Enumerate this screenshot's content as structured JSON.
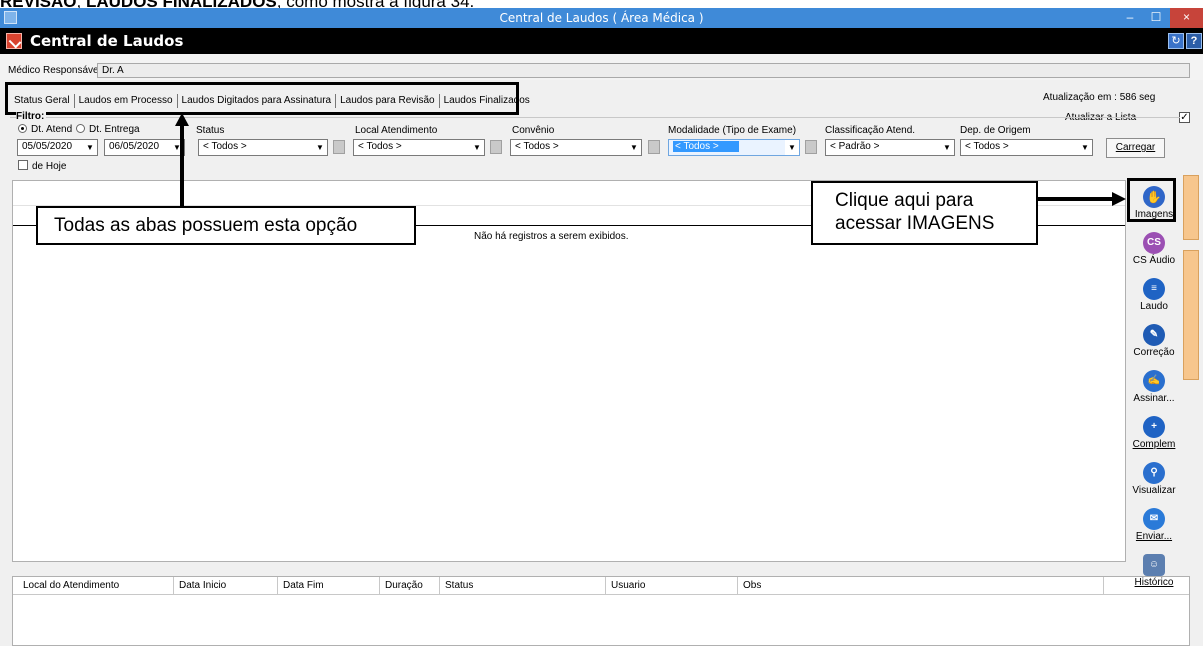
{
  "doc_text_bold1": "REVISÃO",
  "doc_text_sep": ", ",
  "doc_text_bold2": "LAUDOS FINALIZADOS",
  "doc_text_rest": ", como mostra a figura 34.",
  "window": {
    "title": "Central de Laudos ( Área Médica )",
    "min": "–",
    "max": "☐",
    "close": "×"
  },
  "app": {
    "name": "Central de Laudos",
    "sync": "↻",
    "help": "?"
  },
  "medico": {
    "label": "Médico Responsável:",
    "value": "Dr. A"
  },
  "tabs": [
    "Status Geral",
    "Laudos em Processo",
    "Laudos Digitados para Assinatura",
    "Laudos para Revisão",
    "Laudos Finalizados"
  ],
  "update": {
    "text": "Atualização em : 586 seg",
    "auto_label": "Atualizar a Lista",
    "auto_checked": "✓"
  },
  "filter": {
    "title": "Filtro:",
    "radio_atend": "Dt. Atend",
    "radio_entrega": "Dt. Entrega",
    "date_from": "05/05/2020",
    "date_to": "06/05/2020",
    "labels": {
      "status": "Status",
      "local": "Local Atendimento",
      "convenio": "Convênio",
      "modalidade": "Modalidade (Tipo de Exame)",
      "classificacao": "Classificação Atend.",
      "dep_origem": "Dep. de Origem"
    },
    "values": {
      "status": "< Todos >",
      "local": "< Todos >",
      "convenio": "< Todos >",
      "modalidade": "< Todos >",
      "classificacao": "< Padrão >",
      "dep_origem": "< Todos >"
    },
    "hoje": "de Hoje",
    "carregar": "Carregar"
  },
  "grid": {
    "empty_message": "Não há registros a serem exibidos."
  },
  "log": {
    "columns": [
      "Local do Atendimento",
      "Data Inicio",
      "Data Fim",
      "Duração",
      "Status",
      "Usuario",
      "Obs"
    ]
  },
  "toolbar": {
    "imagens": "Imagens",
    "cs_audio": "CS Áudio",
    "cs_badge": "CS",
    "laudo": "Laudo",
    "correcao": "Correção",
    "assinar": "Assinar...",
    "complem": "Complem",
    "visualizar": "Visualizar",
    "enviar": "Enviar...",
    "historico": "Histórico"
  },
  "callouts": {
    "left": "Todas as abas possuem esta opção",
    "right_line1": "Clique aqui para",
    "right_line2": "acessar IMAGENS"
  }
}
